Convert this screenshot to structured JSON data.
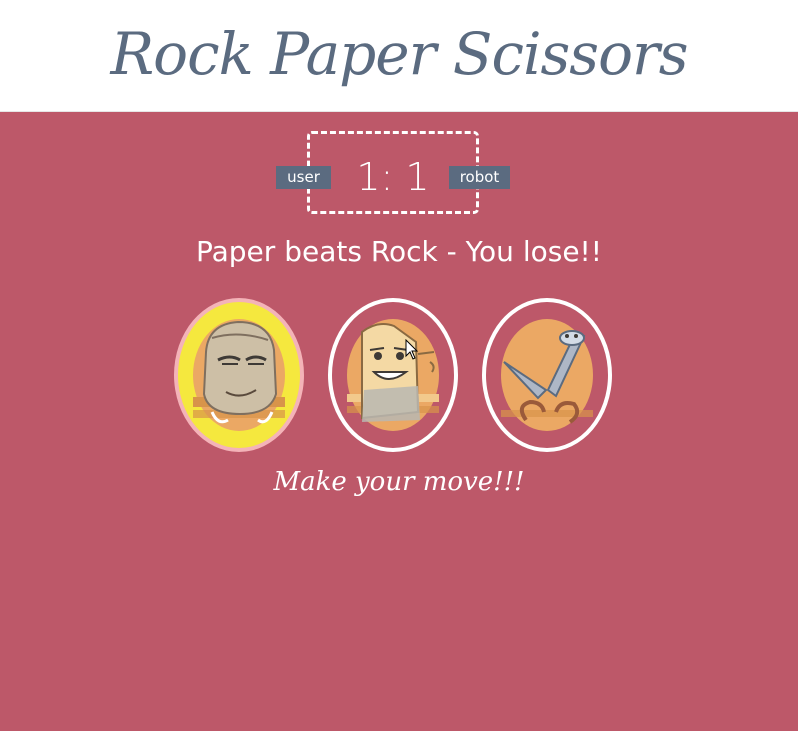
{
  "header": {
    "title": "Rock Paper Scissors"
  },
  "scoreboard": {
    "user_label": "user",
    "robot_label": "robot",
    "score": "1: 1"
  },
  "result_message": "Paper beats Rock - You lose!!",
  "choices": [
    {
      "name": "rock",
      "icon": "rock-character-icon",
      "selected": true
    },
    {
      "name": "paper",
      "icon": "paper-character-icon",
      "selected": false
    },
    {
      "name": "scissors",
      "icon": "scissors-character-icon",
      "selected": false
    }
  ],
  "prompt": "Make your move!!!",
  "colors": {
    "background": "#bd5869",
    "title": "#5b6b80",
    "label_bg": "#5b6b80",
    "selected_fill": "#f5e83e",
    "selected_ring": "#f4b3b8",
    "character_bg": "#eba864"
  }
}
